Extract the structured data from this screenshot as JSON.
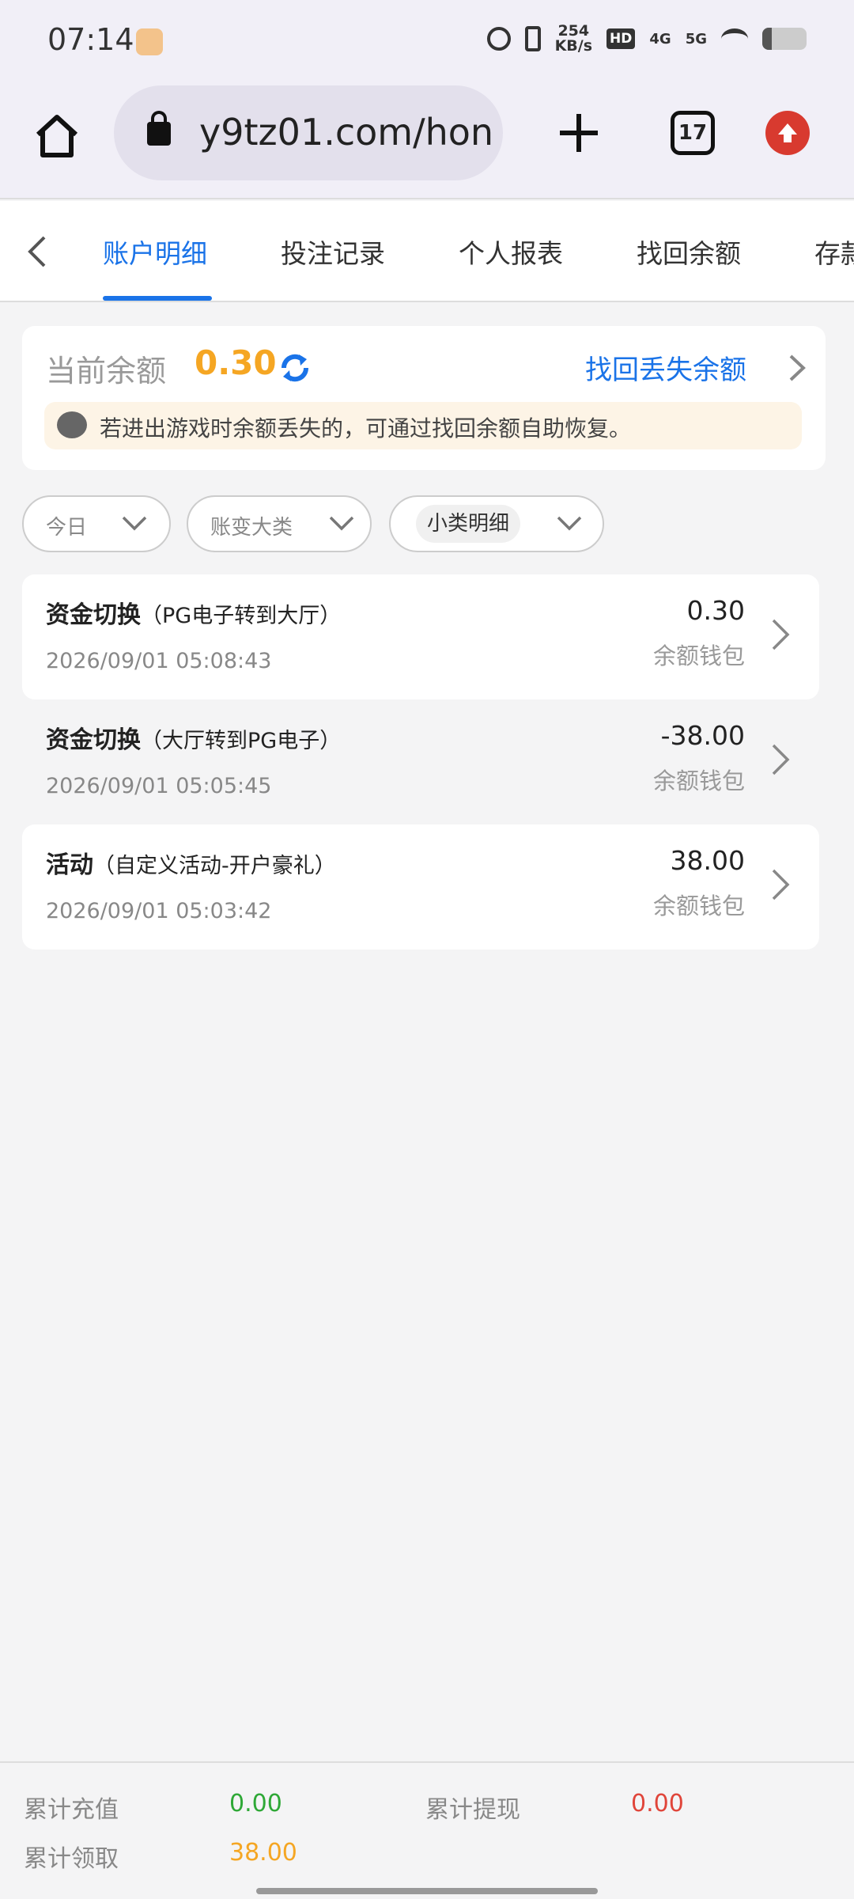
{
  "status_bar": {
    "time": "07:14",
    "speed_value": "254",
    "speed_unit": "KB/s",
    "hd": "HD",
    "net1": "4G",
    "net2": "5G"
  },
  "browser": {
    "url": "y9tz01.com/hon",
    "tab_count": "17"
  },
  "tabs": [
    "账户明细",
    "投注记录",
    "个人报表",
    "找回余额",
    "存款"
  ],
  "balance": {
    "label": "当前余额",
    "value": "0.30",
    "find_link": "找回丢失余额",
    "notice": "若进出游戏时余额丢失的，可通过找回余额自助恢复。"
  },
  "filters": {
    "date": "今日",
    "category": "账变大类",
    "subcategory": "小类明细"
  },
  "records": [
    {
      "type": "资金切换",
      "detail": "（PG电子转到大厅）",
      "time": "2026/09/01 05:08:43",
      "amount": "0.30",
      "wallet": "余额钱包"
    },
    {
      "type": "资金切换",
      "detail": "（大厅转到PG电子）",
      "time": "2026/09/01 05:05:45",
      "amount": "-38.00",
      "wallet": "余额钱包"
    },
    {
      "type": "活动",
      "detail": "（自定义活动-开户豪礼）",
      "time": "2026/09/01 05:03:42",
      "amount": "38.00",
      "wallet": "余额钱包"
    }
  ],
  "footer": {
    "recharge_label": "累计充值",
    "recharge_value": "0.00",
    "withdraw_label": "累计提现",
    "withdraw_value": "0.00",
    "claim_label": "累计领取",
    "claim_value": "38.00"
  },
  "colors": {
    "accent": "#1a73e8",
    "balance": "#f5a623",
    "positive": "#2ea836",
    "negative": "#e0453a"
  }
}
